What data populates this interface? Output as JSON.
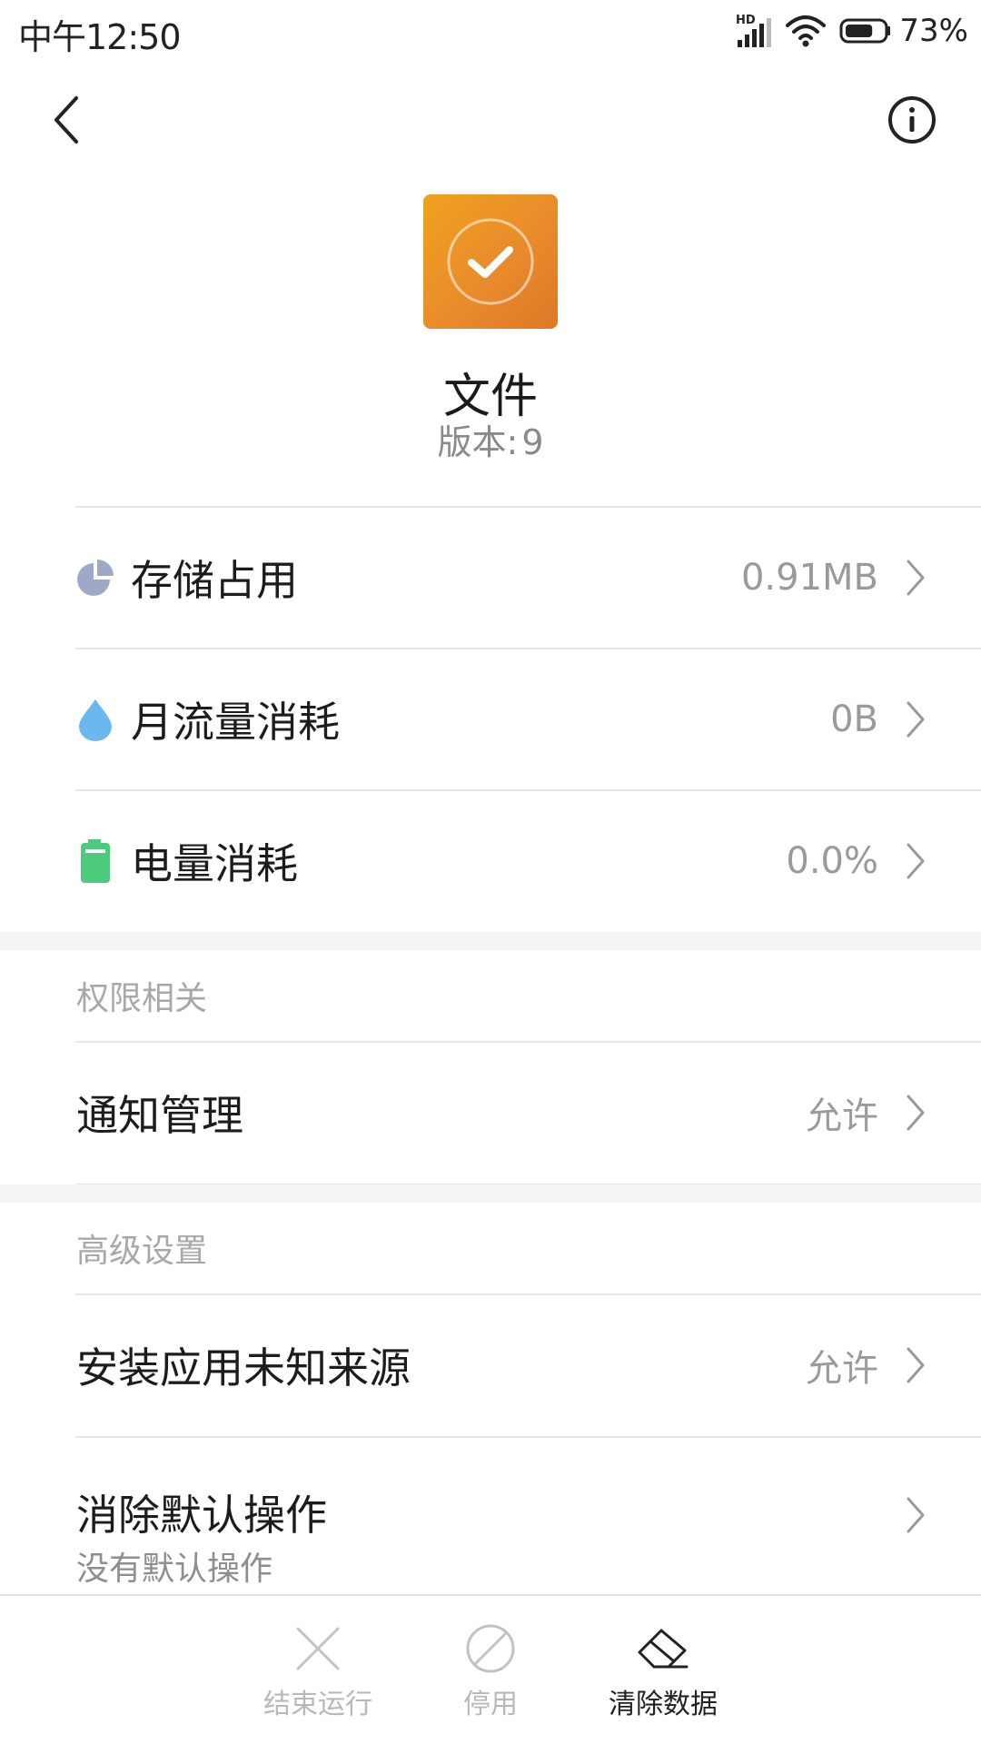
{
  "status_bar": {
    "time": "中午12:50",
    "network_badge": "HD",
    "battery_percent": "73%",
    "battery_level": 0.73,
    "icons": [
      "signal-icon",
      "wifi-icon",
      "battery-icon"
    ]
  },
  "header": {
    "back_icon": "chevron-left-icon",
    "info_icon": "info-circle-icon"
  },
  "app": {
    "name": "文件",
    "version_label": "版本:",
    "version_value": "9",
    "icon": "checkmark-circle-icon",
    "icon_color": "#EB931F"
  },
  "usage_rows": [
    {
      "label": "存储占用",
      "value": "0.91MB",
      "icon": "pie-chart-icon",
      "icon_color": "#A0A8C8"
    },
    {
      "label": "月流量消耗",
      "value": "0B",
      "icon": "water-drop-icon",
      "icon_color": "#6BB8EE"
    },
    {
      "label": "电量消耗",
      "value": "0.0%",
      "icon": "battery-icon",
      "icon_color": "#4CCB7C"
    }
  ],
  "permissions_section": {
    "title": "权限相关",
    "rows": [
      {
        "label": "通知管理",
        "value": "允许"
      }
    ]
  },
  "advanced_section": {
    "title": "高级设置",
    "rows": [
      {
        "label": "安装应用未知来源",
        "value": "允许"
      },
      {
        "label": "消除默认操作",
        "sublabel": "没有默认操作"
      }
    ]
  },
  "bottom_actions": [
    {
      "label": "结束运行",
      "icon": "close-x-icon",
      "enabled": false
    },
    {
      "label": "停用",
      "icon": "disable-circle-icon",
      "enabled": false
    },
    {
      "label": "清除数据",
      "icon": "eraser-icon",
      "enabled": true
    }
  ],
  "colors": {
    "divider": "#E6E6E6",
    "value_text": "#9A9A9A",
    "section_title": "#A8A8A8",
    "disabled_action": "#B8B8B8"
  }
}
